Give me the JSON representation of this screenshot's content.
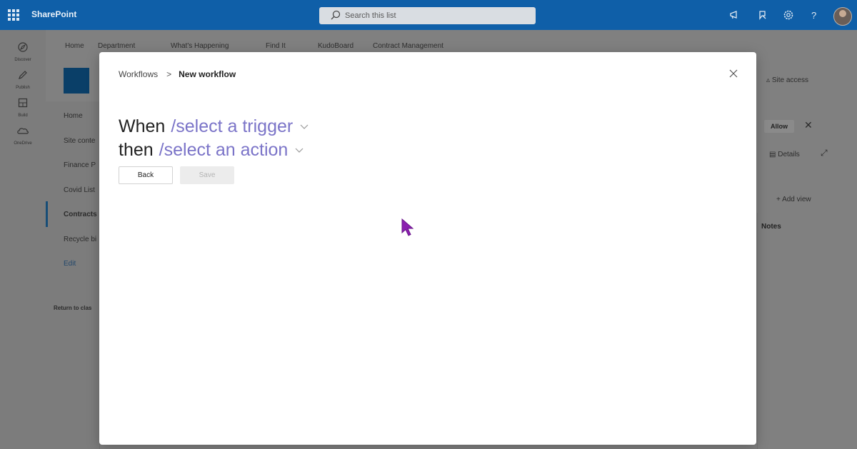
{
  "topbar": {
    "app_name": "SharePoint",
    "search_placeholder": "Search this list"
  },
  "left_rail": [
    {
      "label": "Discover",
      "icon": "compass-icon"
    },
    {
      "label": "Publish",
      "icon": "pen-icon"
    },
    {
      "label": "Build",
      "icon": "grid-icon"
    },
    {
      "label": "OneDrive",
      "icon": "cloud-icon"
    }
  ],
  "site_nav": [
    "Home",
    "Department",
    "What's Happening",
    "Find It",
    "KudoBoard",
    "Contract Management"
  ],
  "left_nav": {
    "items": [
      "Home",
      "Site conte",
      "Finance P",
      "Covid List",
      "Contracts",
      "Recycle bi"
    ],
    "edit_label": "Edit",
    "return_label": "Return to clas"
  },
  "right_panel": {
    "site_access": "Site access",
    "allow": "Allow",
    "details": "Details",
    "add_view": "Add view",
    "notes": "Notes"
  },
  "modal": {
    "breadcrumb_root": "Workflows",
    "breadcrumb_current": "New workflow",
    "when_text": "When",
    "trigger_link": "/select a trigger",
    "then_text": "then",
    "action_link": "/select an action",
    "back_label": "Back",
    "save_label": "Save"
  }
}
